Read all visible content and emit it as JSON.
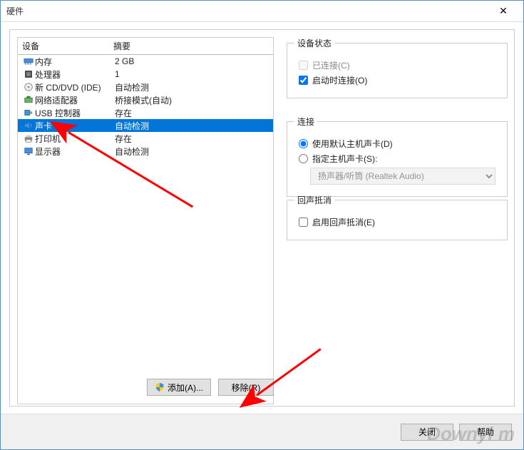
{
  "window": {
    "title": "硬件"
  },
  "device_list": {
    "header": {
      "col1": "设备",
      "col2": "摘要"
    },
    "items": [
      {
        "icon": "memory",
        "label": "内存",
        "summary": "2 GB"
      },
      {
        "icon": "cpu",
        "label": "处理器",
        "summary": "1"
      },
      {
        "icon": "cd",
        "label": "新 CD/DVD (IDE)",
        "summary": "自动检测"
      },
      {
        "icon": "net",
        "label": "网络适配器",
        "summary": "桥接模式(自动)"
      },
      {
        "icon": "usb",
        "label": "USB 控制器",
        "summary": "存在"
      },
      {
        "icon": "sound",
        "label": "声卡",
        "summary": "自动检测",
        "selected": true
      },
      {
        "icon": "printer",
        "label": "打印机",
        "summary": "存在"
      },
      {
        "icon": "display",
        "label": "显示器",
        "summary": "自动检测"
      }
    ]
  },
  "status": {
    "legend": "设备状态",
    "connected_label": "已连接(C)",
    "connected_checked": false,
    "connected_disabled": true,
    "boot_connect_label": "启动时连接(O)",
    "boot_connect_checked": true
  },
  "connection": {
    "legend": "连接",
    "default_label": "使用默认主机声卡(D)",
    "specify_label": "指定主机声卡(S):",
    "selected_option": "扬声器/听筒 (Realtek Audio)",
    "radio_value": "default"
  },
  "echo": {
    "legend": "回声抵消",
    "enable_label": "启用回声抵消(E)",
    "enable_checked": false
  },
  "buttons": {
    "add": "添加(A)...",
    "remove": "移除(R)",
    "close": "关闭",
    "help": "帮助"
  },
  "watermark": "Downyi m"
}
